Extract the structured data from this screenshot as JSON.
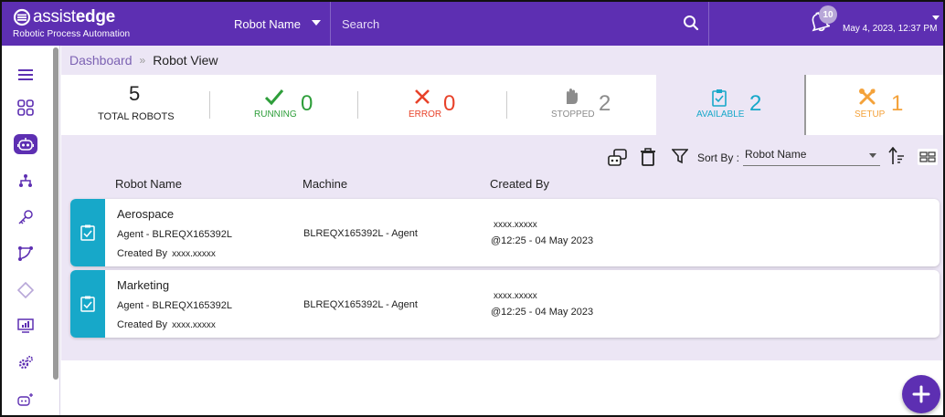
{
  "header": {
    "logo_a": "assist",
    "logo_b": "edge",
    "logo_sub": "Robotic Process Automation",
    "robot_select": "Robot Name",
    "search_placeholder": "Search",
    "notification_count": "10",
    "datetime": "May 4, 2023, 12:37 PM",
    "color_brand": "#5d2fb2"
  },
  "sidebar": {
    "items": [
      {
        "icon": "menu-icon"
      },
      {
        "icon": "dashboard-grid-icon"
      },
      {
        "icon": "robot-icon",
        "active": true
      },
      {
        "icon": "hierarchy-icon"
      },
      {
        "icon": "key-icon"
      },
      {
        "icon": "workflow-icon"
      },
      {
        "icon": "diamond-icon"
      },
      {
        "icon": "monitor-chart-icon"
      },
      {
        "icon": "settings-gears-icon"
      },
      {
        "icon": "add-robot-icon"
      }
    ]
  },
  "breadcrumb": {
    "link": "Dashboard",
    "current": "Robot View"
  },
  "stats": {
    "total": {
      "value": "5",
      "label": "TOTAL ROBOTS"
    },
    "running": {
      "value": "0",
      "label": "RUNNING",
      "color": "#2e9e3a"
    },
    "error": {
      "value": "0",
      "label": "ERROR",
      "color": "#e8422a"
    },
    "stopped": {
      "value": "2",
      "label": "STOPPED",
      "color": "#8c8c8c"
    },
    "available": {
      "value": "2",
      "label": "AVAILABLE",
      "color": "#17a8c9"
    },
    "setup": {
      "value": "1",
      "label": "SETUP",
      "color": "#f4a23a"
    }
  },
  "toolbar": {
    "sort_label": "Sort By :",
    "sort_value": "Robot Name"
  },
  "columns": {
    "name": "Robot Name",
    "machine": "Machine",
    "created_by": "Created By"
  },
  "robots": [
    {
      "name": "Aerospace",
      "agent": "Agent - BLREQX165392L",
      "created_label": "Created By",
      "created_value": "xxxx.xxxxx",
      "machine": "BLREQX165392L - Agent",
      "by": "xxxx.xxxxx",
      "at": "@12:25 - 04 May 2023"
    },
    {
      "name": "Marketing",
      "agent": "Agent - BLREQX165392L",
      "created_label": "Created By",
      "created_value": "xxxx.xxxxx",
      "machine": "BLREQX165392L - Agent",
      "by": "xxxx.xxxxx",
      "at": "@12:25 - 04 May 2023"
    }
  ]
}
